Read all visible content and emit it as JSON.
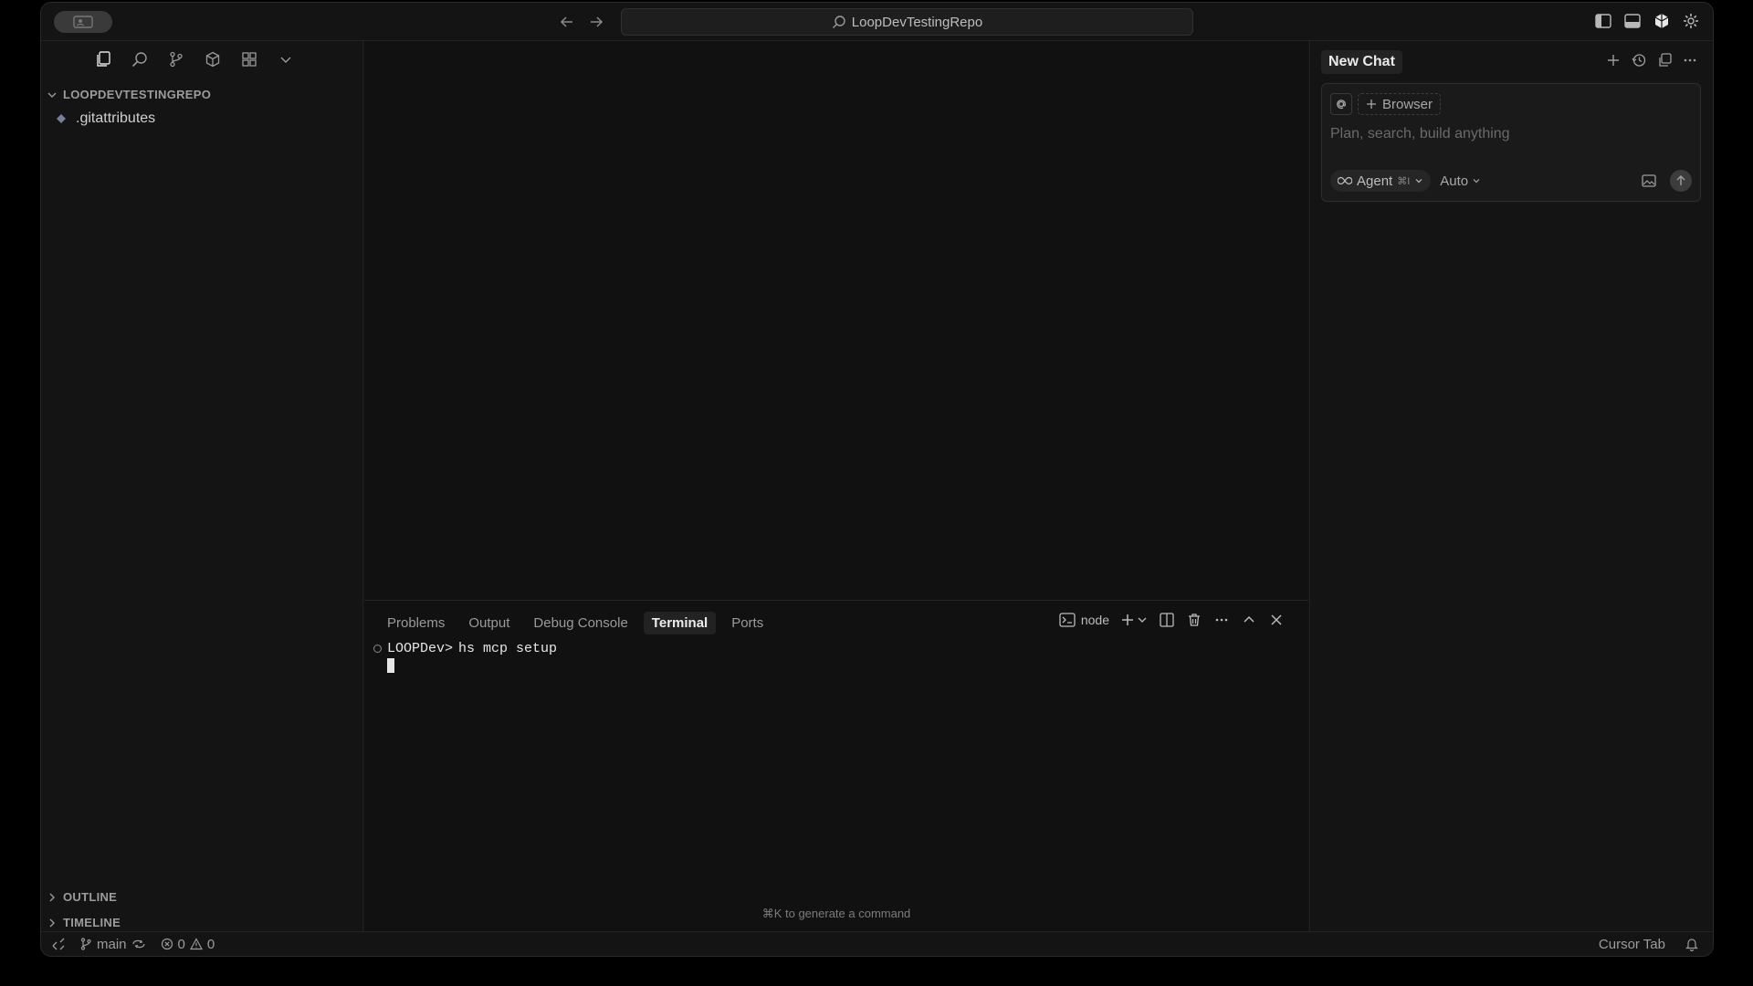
{
  "titlebar": {
    "search_label": "LoopDevTestingRepo"
  },
  "sidebar": {
    "explorer_heading": "LOOPDEVTESTINGREPO",
    "files": [
      ".gitattributes"
    ],
    "outline_heading": "OUTLINE",
    "timeline_heading": "TIMELINE"
  },
  "panel": {
    "tabs": [
      "Problems",
      "Output",
      "Debug Console",
      "Terminal",
      "Ports"
    ],
    "active_tab": "Terminal",
    "terminal_name": "node",
    "prompt": "LOOPDev>",
    "command": "hs mcp setup",
    "hint": "⌘K to generate a command"
  },
  "chat": {
    "title": "New Chat",
    "context_pill": "Browser",
    "placeholder": "Plan, search, build anything",
    "mode": "Agent",
    "mode_shortcut": "⌘I",
    "model": "Auto"
  },
  "statusbar": {
    "branch": "main",
    "errors": "0",
    "warnings": "0",
    "right_label": "Cursor Tab"
  }
}
